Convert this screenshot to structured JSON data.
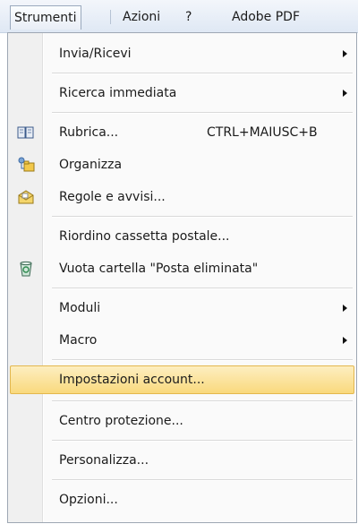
{
  "menubar": {
    "items": [
      {
        "label": "Strumenti",
        "active": true
      },
      {
        "label": "Azioni"
      },
      {
        "label": "?"
      },
      {
        "label": "Adobe PDF"
      }
    ]
  },
  "menu": {
    "items": [
      {
        "label": "Invia/Ricevi",
        "submenu": true
      },
      {
        "label": "Ricerca immediata",
        "submenu": true
      },
      {
        "label": "Rubrica...",
        "shortcut": "CTRL+MAIUSC+B",
        "icon": "address-book-icon"
      },
      {
        "label": "Organizza",
        "icon": "organize-icon"
      },
      {
        "label": "Regole e avvisi...",
        "icon": "rules-alerts-icon"
      },
      {
        "label": "Riordino cassetta postale..."
      },
      {
        "label": "Vuota cartella \"Posta eliminata\"",
        "icon": "empty-trash-icon"
      },
      {
        "label": "Moduli",
        "submenu": true
      },
      {
        "label": "Macro",
        "submenu": true
      },
      {
        "label": "Impostazioni account...",
        "highlighted": true
      },
      {
        "label": "Centro protezione..."
      },
      {
        "label": "Personalizza..."
      },
      {
        "label": "Opzioni..."
      }
    ]
  },
  "colors": {
    "highlight": "#f9d97d",
    "highlight_border": "#e3b74d",
    "menubar_bg": "#dfe8f4",
    "gutter": "#f0f0f0"
  }
}
